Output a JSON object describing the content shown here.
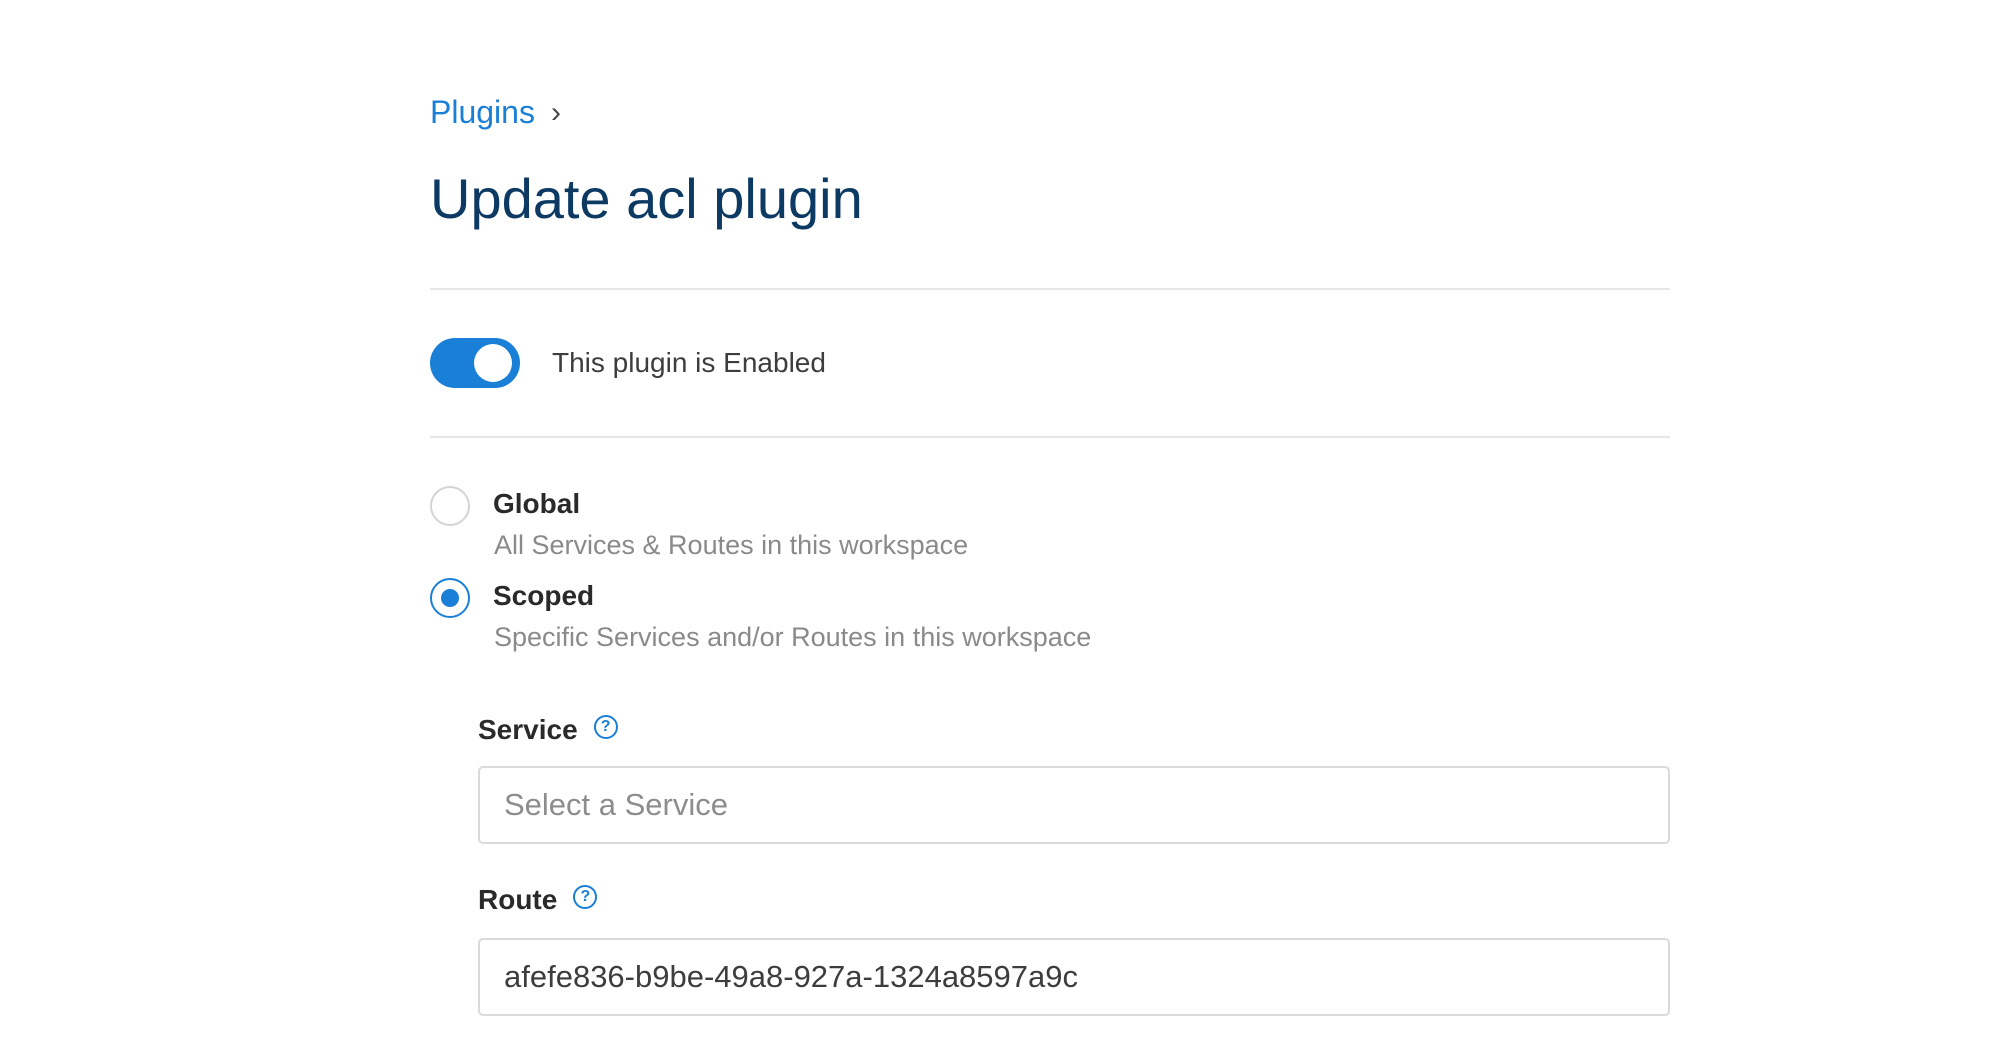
{
  "breadcrumb": {
    "link": "Plugins",
    "separator": "›"
  },
  "title": "Update acl plugin",
  "toggle": {
    "enabled": true,
    "label": "This plugin is Enabled",
    "accent_color": "#1a7fd6"
  },
  "scope": {
    "selected": "scoped",
    "options": [
      {
        "id": "global",
        "title": "Global",
        "description": "All Services & Routes in this workspace"
      },
      {
        "id": "scoped",
        "title": "Scoped",
        "description": "Specific Services and/or Routes in this workspace"
      }
    ]
  },
  "fields": {
    "service": {
      "label": "Service",
      "help_icon": "?",
      "placeholder": "Select a Service",
      "value": ""
    },
    "route": {
      "label": "Route",
      "help_icon": "?",
      "placeholder": "",
      "value": "afefe836-b9be-49a8-927a-1324a8597a9c"
    }
  }
}
